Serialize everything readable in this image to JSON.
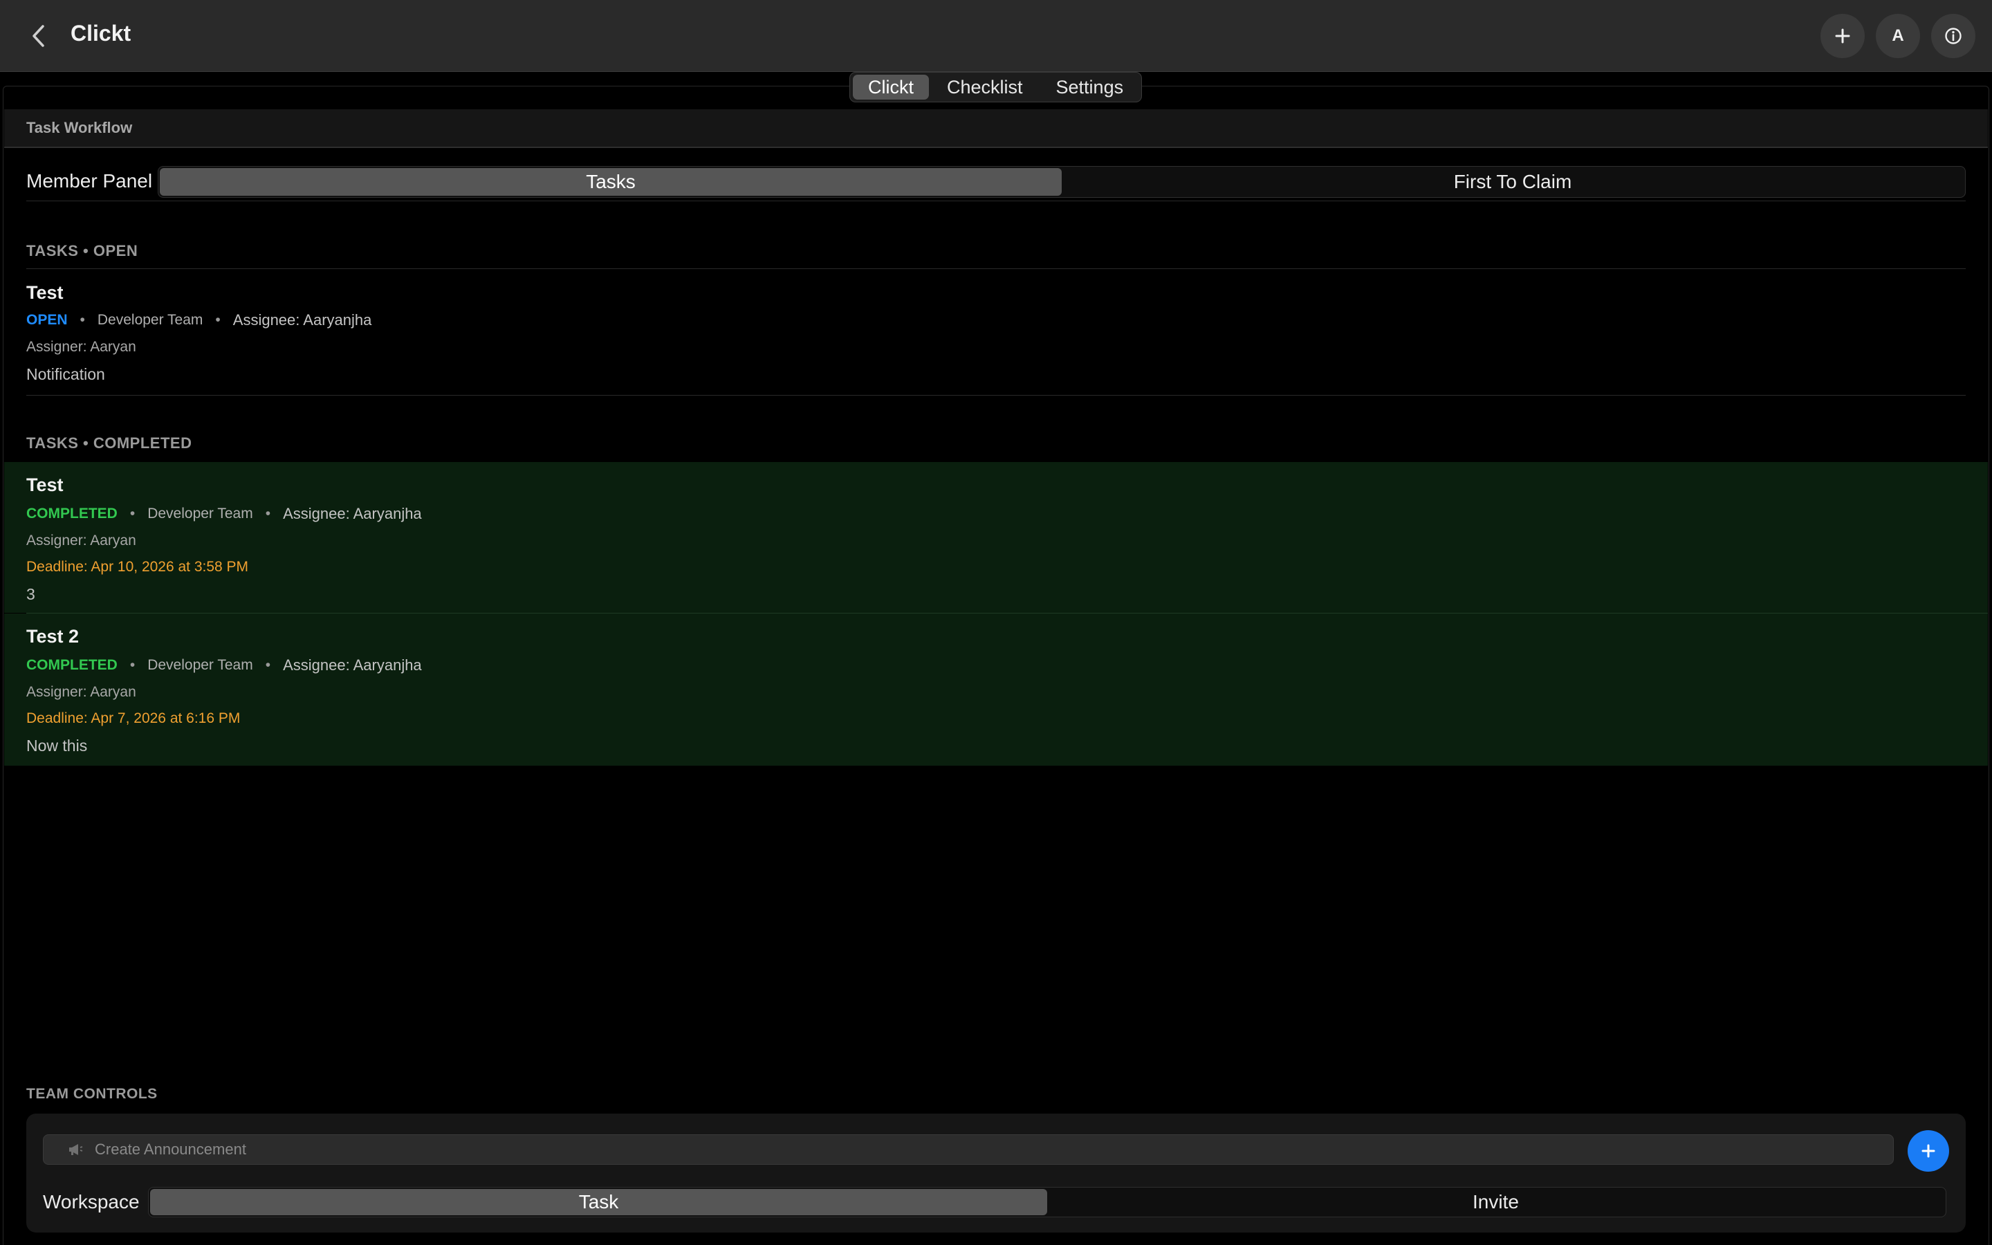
{
  "window": {
    "title": "Clickt",
    "actions": {
      "avatar_letter": "A"
    }
  },
  "tabs": [
    {
      "label": "Clickt",
      "active": true
    },
    {
      "label": "Checklist",
      "active": false
    },
    {
      "label": "Settings",
      "active": false
    }
  ],
  "section": {
    "title": "Task Workflow"
  },
  "member_panel": {
    "label": "Member Panel",
    "options": [
      {
        "label": "Tasks",
        "active": true
      },
      {
        "label": "First To Claim",
        "active": false
      }
    ]
  },
  "open_tasks": {
    "heading": "TASKS • OPEN",
    "items": [
      {
        "title": "Test",
        "status": "OPEN",
        "team": "Developer Team",
        "assignee": "Assignee: Aaryanjha",
        "assigner": "Assigner: Aaryan",
        "note": "Notification"
      }
    ]
  },
  "completed_tasks": {
    "heading": "TASKS • COMPLETED",
    "items": [
      {
        "title": "Test",
        "status": "COMPLETED",
        "team": "Developer Team",
        "assignee": "Assignee: Aaryanjha",
        "assigner": "Assigner: Aaryan",
        "deadline": "Deadline: Apr 10, 2026 at 3:58 PM",
        "note": "3"
      },
      {
        "title": "Test 2",
        "status": "COMPLETED",
        "team": "Developer Team",
        "assignee": "Assignee: Aaryanjha",
        "assigner": "Assigner: Aaryan",
        "deadline": "Deadline: Apr 7, 2026 at 6:16 PM",
        "note": "Now this"
      }
    ]
  },
  "team_controls": {
    "heading": "TEAM CONTROLS",
    "announcement_placeholder": "Create Announcement",
    "workspace": {
      "label": "Workspace",
      "options": [
        {
          "label": "Task",
          "active": true
        },
        {
          "label": "Invite",
          "active": false
        }
      ]
    }
  },
  "colors": {
    "open": "#1f8cff",
    "completed": "#32c850",
    "deadline": "#f0a030",
    "completed_row_bg": "#0a1f0e",
    "accent": "#1a7cf5"
  },
  "icons": [
    "back-chevron-icon",
    "plus-icon",
    "info-icon",
    "megaphone-icon"
  ]
}
